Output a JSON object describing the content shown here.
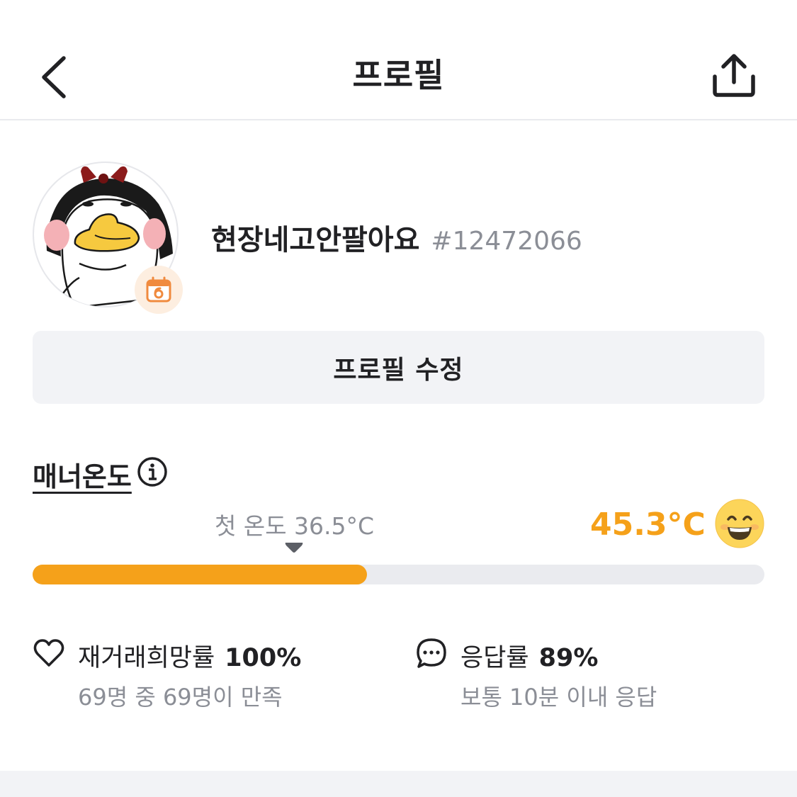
{
  "header": {
    "title": "프로필",
    "back_icon": "chevron-left-icon",
    "share_icon": "share-icon"
  },
  "profile": {
    "nickname": "현장네고안팔아요",
    "user_id": "#12472066",
    "avatar_icon": "duck-character-avatar",
    "badge_icon": "calendar-badge-icon",
    "edit_button": "프로필 수정"
  },
  "manner": {
    "title": "매너온도",
    "info_icon": "info-icon",
    "first_temp_label": "첫 온도 36.5°C",
    "temperature": "45.3°C",
    "temperature_value": 45.3,
    "gauge_fill_ratio": 0.457,
    "face_icon": "smiling-face-icon",
    "accent_color": "#f5a11a"
  },
  "stats": {
    "rehire": {
      "icon": "heart-icon",
      "label": "재거래희망률",
      "value": "100%",
      "sub": "69명 중 69명이 만족"
    },
    "response": {
      "icon": "chat-bubble-icon",
      "label": "응답률",
      "value": "89%",
      "sub": "보통 10분 이내 응답"
    }
  }
}
